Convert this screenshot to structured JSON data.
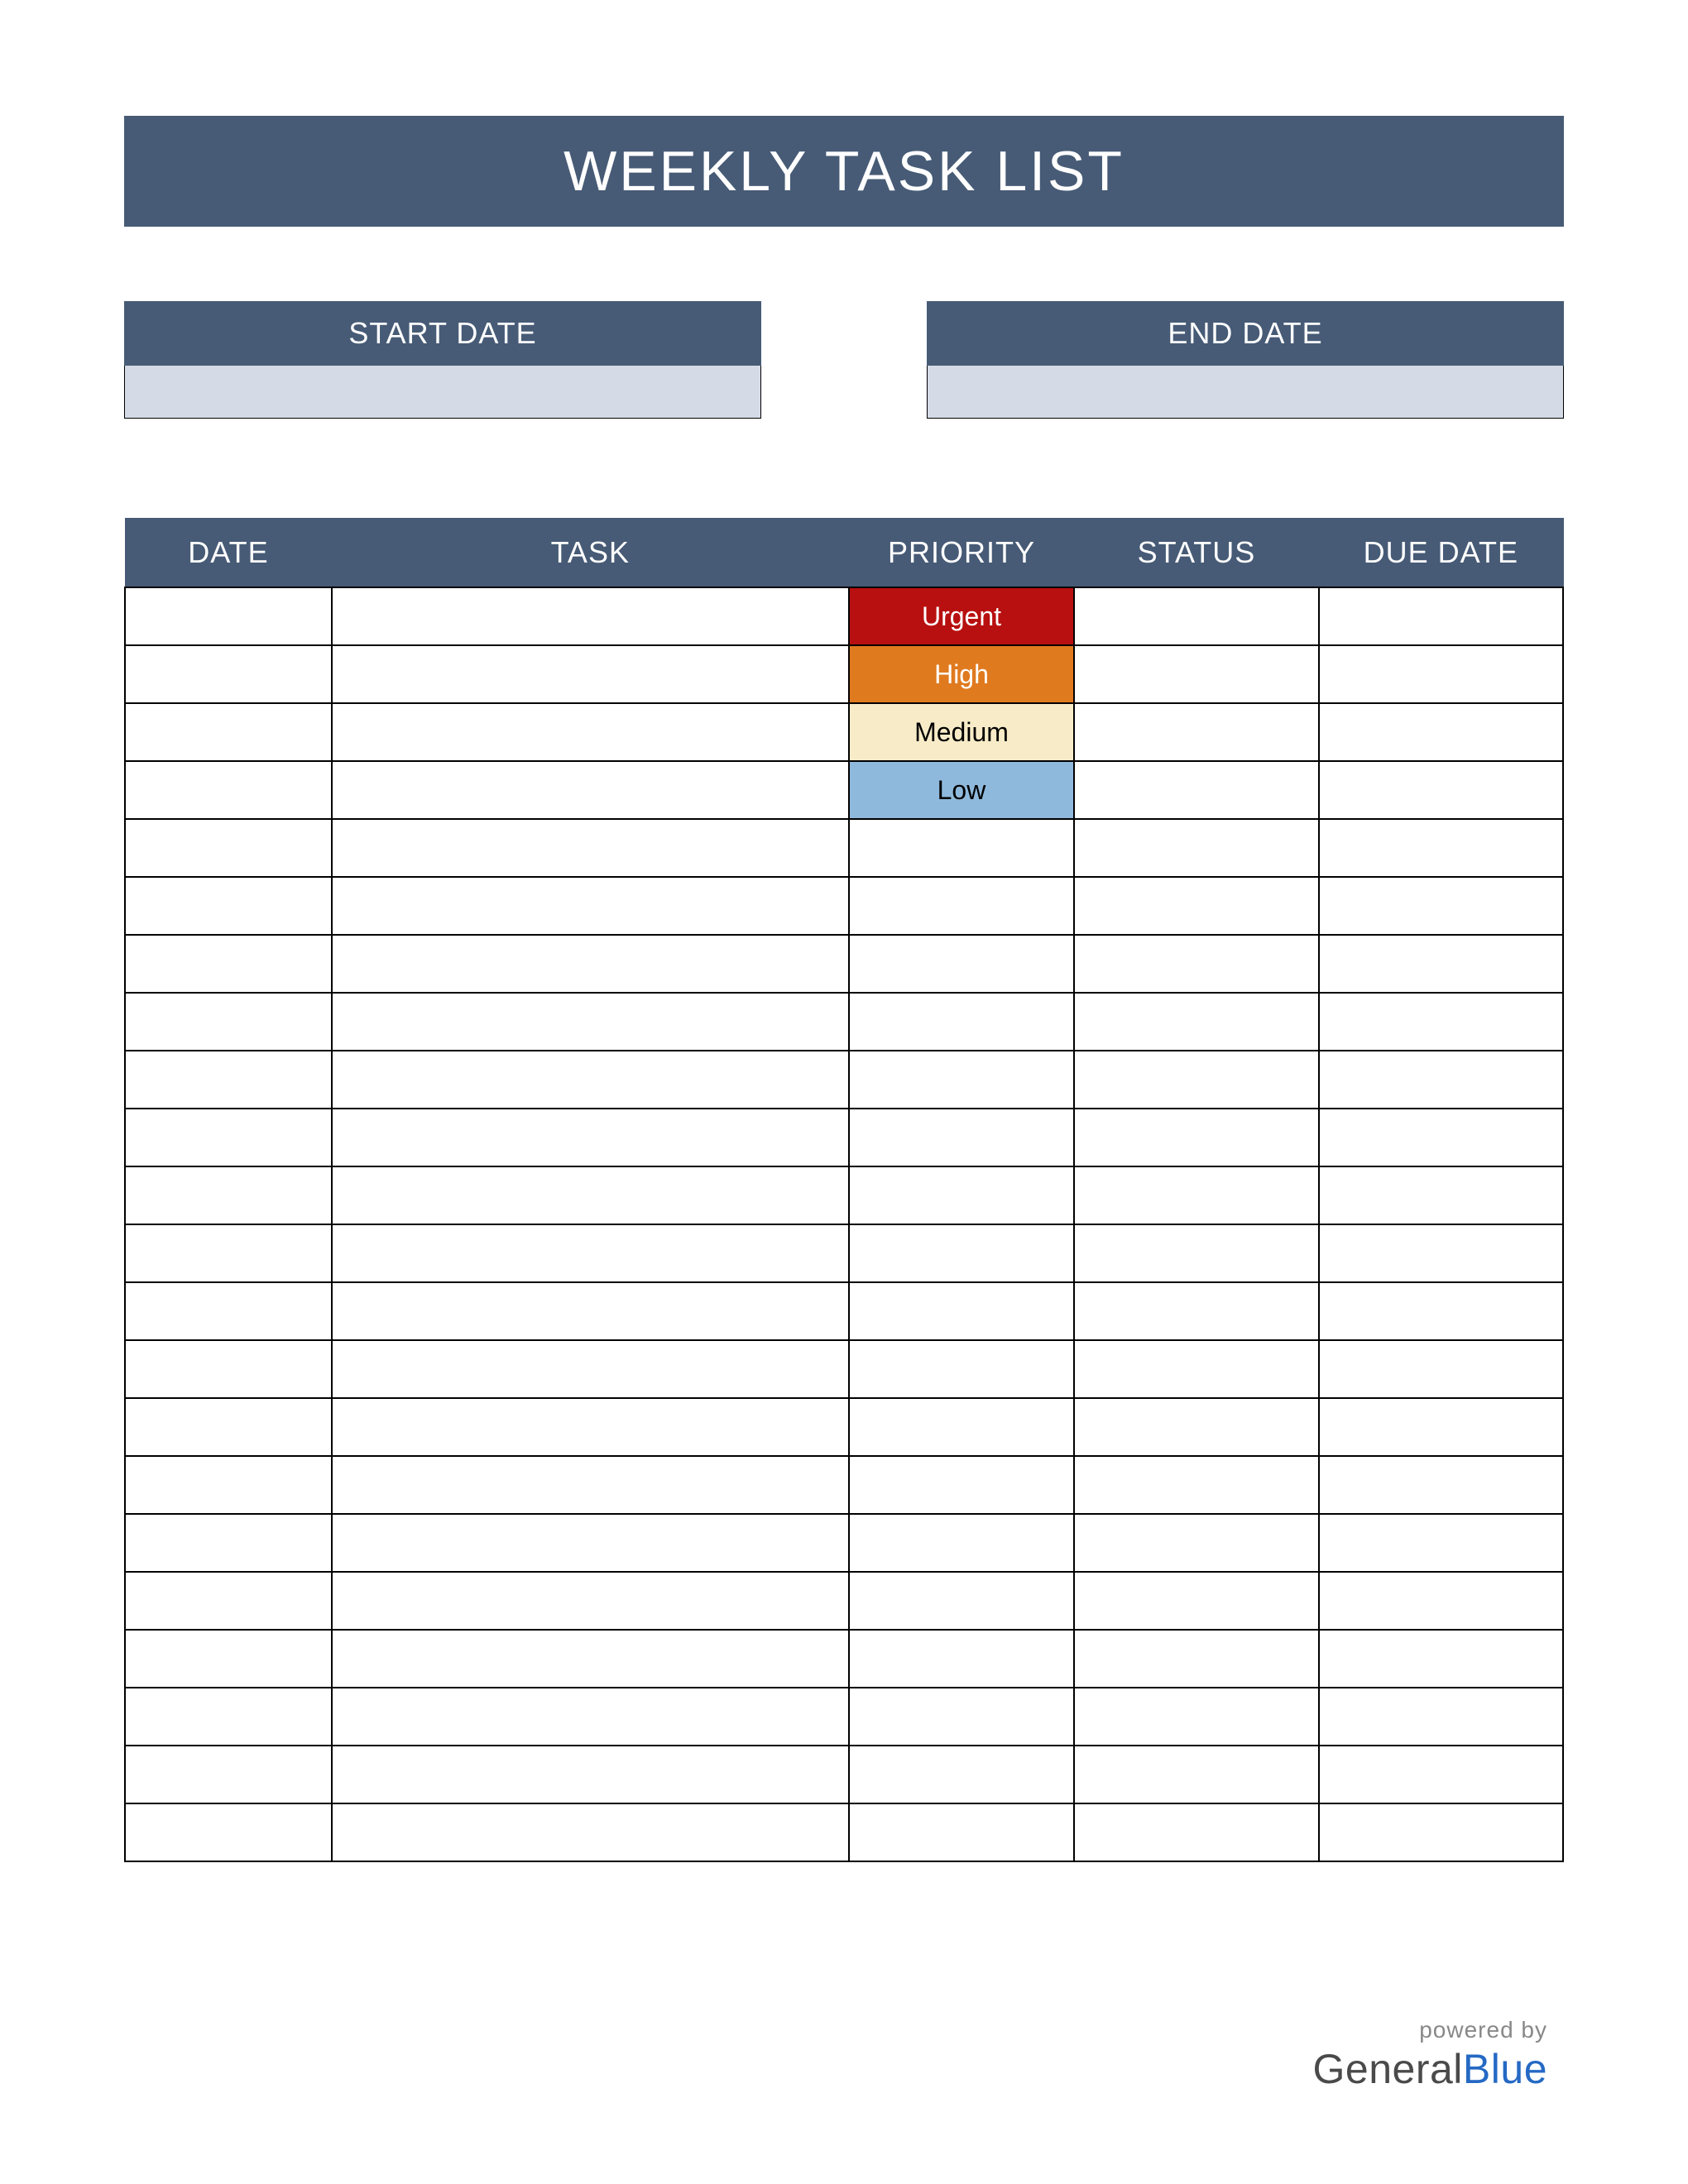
{
  "title": "WEEKLY TASK LIST",
  "dates": {
    "start_label": "START DATE",
    "start_value": "",
    "end_label": "END DATE",
    "end_value": ""
  },
  "columns": {
    "date": "DATE",
    "task": "TASK",
    "priority": "PRIORITY",
    "status": "STATUS",
    "due": "DUE DATE"
  },
  "rows": [
    {
      "date": "",
      "task": "",
      "priority": "Urgent",
      "priority_class": "priority-urgent",
      "status": "",
      "due": ""
    },
    {
      "date": "",
      "task": "",
      "priority": "High",
      "priority_class": "priority-high",
      "status": "",
      "due": ""
    },
    {
      "date": "",
      "task": "",
      "priority": "Medium",
      "priority_class": "priority-medium",
      "status": "",
      "due": ""
    },
    {
      "date": "",
      "task": "",
      "priority": "Low",
      "priority_class": "priority-low",
      "status": "",
      "due": ""
    },
    {
      "date": "",
      "task": "",
      "priority": "",
      "priority_class": "",
      "status": "",
      "due": ""
    },
    {
      "date": "",
      "task": "",
      "priority": "",
      "priority_class": "",
      "status": "",
      "due": ""
    },
    {
      "date": "",
      "task": "",
      "priority": "",
      "priority_class": "",
      "status": "",
      "due": ""
    },
    {
      "date": "",
      "task": "",
      "priority": "",
      "priority_class": "",
      "status": "",
      "due": ""
    },
    {
      "date": "",
      "task": "",
      "priority": "",
      "priority_class": "",
      "status": "",
      "due": ""
    },
    {
      "date": "",
      "task": "",
      "priority": "",
      "priority_class": "",
      "status": "",
      "due": ""
    },
    {
      "date": "",
      "task": "",
      "priority": "",
      "priority_class": "",
      "status": "",
      "due": ""
    },
    {
      "date": "",
      "task": "",
      "priority": "",
      "priority_class": "",
      "status": "",
      "due": ""
    },
    {
      "date": "",
      "task": "",
      "priority": "",
      "priority_class": "",
      "status": "",
      "due": ""
    },
    {
      "date": "",
      "task": "",
      "priority": "",
      "priority_class": "",
      "status": "",
      "due": ""
    },
    {
      "date": "",
      "task": "",
      "priority": "",
      "priority_class": "",
      "status": "",
      "due": ""
    },
    {
      "date": "",
      "task": "",
      "priority": "",
      "priority_class": "",
      "status": "",
      "due": ""
    },
    {
      "date": "",
      "task": "",
      "priority": "",
      "priority_class": "",
      "status": "",
      "due": ""
    },
    {
      "date": "",
      "task": "",
      "priority": "",
      "priority_class": "",
      "status": "",
      "due": ""
    },
    {
      "date": "",
      "task": "",
      "priority": "",
      "priority_class": "",
      "status": "",
      "due": ""
    },
    {
      "date": "",
      "task": "",
      "priority": "",
      "priority_class": "",
      "status": "",
      "due": ""
    },
    {
      "date": "",
      "task": "",
      "priority": "",
      "priority_class": "",
      "status": "",
      "due": ""
    },
    {
      "date": "",
      "task": "",
      "priority": "",
      "priority_class": "",
      "status": "",
      "due": ""
    }
  ],
  "footer": {
    "powered": "powered by",
    "brand_general": "General",
    "brand_blue": "Blue"
  }
}
